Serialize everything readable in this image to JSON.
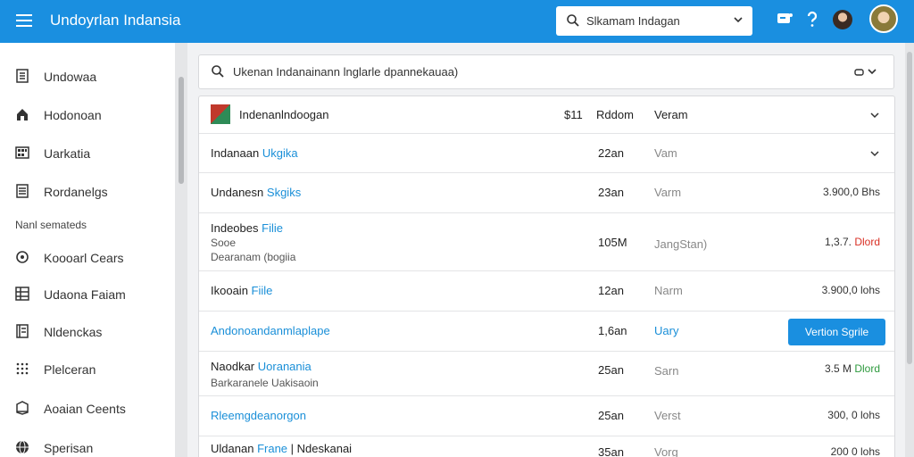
{
  "header": {
    "app_title": "Undoyrlan Indansia",
    "search_value": "Slkamam Indagan"
  },
  "sidebar": {
    "items": [
      {
        "label": "Undowaa",
        "icon": "document-icon"
      },
      {
        "label": "Hodonoan",
        "icon": "home-icon"
      },
      {
        "label": "Uarkatia",
        "icon": "grid-icon"
      },
      {
        "label": "Rordanelgs",
        "icon": "list-icon"
      }
    ],
    "section_label": "Nanl semateds",
    "items2": [
      {
        "label": "Koooarl Cears",
        "icon": "circle-icon"
      },
      {
        "label": "Udaona Faiam",
        "icon": "table-icon"
      },
      {
        "label": "Nldenckas",
        "icon": "book-icon"
      },
      {
        "label": "Plelceran",
        "icon": "dots-icon"
      },
      {
        "label": "Aoaian Ceents",
        "icon": "box-icon"
      },
      {
        "label": "Sperisan",
        "icon": "globe-icon"
      }
    ]
  },
  "search_bar": {
    "value": "Ukenan Indanainann lnglarle dpannekauaa)"
  },
  "list": {
    "header": {
      "name": "Indenanlndoogan",
      "col1": "$11",
      "col2": "Rddom",
      "col3": "Veram"
    },
    "rows": [
      {
        "name": "Indanaan",
        "link": "Ukgika",
        "size": "22an",
        "type": "Vam"
      },
      {
        "name": "Undanesn",
        "link": "Skgiks",
        "size": "23an",
        "type": "Varm",
        "amount": "3.900,0 Bhs"
      },
      {
        "name": "Indeobes",
        "link": "Filie",
        "sub1": "Sooe",
        "sub2": "Dearanam (bogiia",
        "size": "105M",
        "type": "JangStan)",
        "amount": "1,3.7.",
        "amount_tag": "Dlord"
      },
      {
        "name": "Ikooain",
        "link": "Fiile",
        "size": "12an",
        "type": "Narm",
        "amount": "3.900,0 lohs"
      },
      {
        "name": "",
        "link": "Andonoandanmlaplape",
        "size": "1,6an",
        "type": "Uary",
        "button": "Vertion Sgrile"
      },
      {
        "name": "Naodkar",
        "link": "Uoranania",
        "sub1": "Barkaranele Uakisaoin",
        "size": "25an",
        "type": "Sarn",
        "amount": "3.5 M",
        "amount_tag": "Dlord"
      },
      {
        "name": "",
        "link": "Rleemgdeanorgon",
        "size": "25an",
        "type": "Verst",
        "amount": "300, 0 lohs"
      },
      {
        "name": "Uldanan",
        "link": "Frane",
        "name2": "Ndeskanai",
        "size": "35an",
        "type": "Vorg",
        "amount": "200 0 lohs"
      }
    ]
  },
  "colors": {
    "topbar": "#1a8fe0",
    "link": "#1a8fd8",
    "red": "#d93025",
    "green": "#2e9a3e"
  }
}
